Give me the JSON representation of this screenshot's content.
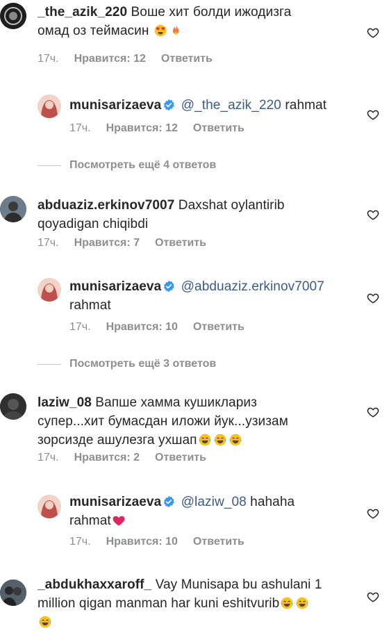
{
  "comments": [
    {
      "username": "_the_azik_220",
      "text": "Воше хит болди ижодизга омад оз теймасин",
      "line2": "омад оз теймасин",
      "time": "17ч.",
      "likes": "Нравится: 12",
      "reply": "Ответить"
    },
    {
      "username": "munisarizaeva",
      "mention": "@_the_azik_220",
      "text": "rahmat",
      "time": "17ч.",
      "likes": "Нравится: 12",
      "reply": "Ответить"
    },
    {
      "view_more": "Посмотреть ещё 4 ответов"
    },
    {
      "username": "abduaziz.erkinov7007",
      "text": "Daxshat oylantirib",
      "line2": "qoyadigan chiqibdi",
      "time": "17ч.",
      "likes": "Нравится: 7",
      "reply": "Ответить"
    },
    {
      "username": "munisarizaeva",
      "mention": "@abduaziz.erkinov7007",
      "line2": "rahmat",
      "time": "17ч.",
      "likes": "Нравится: 10",
      "reply": "Ответить"
    },
    {
      "view_more": "Посмотреть ещё 3 ответов"
    },
    {
      "username": "laziw_08",
      "text": "Вапше хамма кушиклариз",
      "line2": "супер...хит бумасдан иложи йук...узизам",
      "line3": "зорсизде ашулезга ухшап",
      "time": "17ч.",
      "likes": "Нравится: 2",
      "reply": "Ответить"
    },
    {
      "username": "munisarizaeva",
      "mention": "@laziw_08",
      "text": "hahaha",
      "line2": "rahmat",
      "time": "17ч.",
      "likes": "Нравится: 10",
      "reply": "Ответить"
    },
    {
      "username": "_abdukhaxxaroff_",
      "text": "Vay Munisapa bu ashulani 1",
      "line2": "million qigan manman har kuni eshitvurib"
    }
  ],
  "line1_c0": "Воше хит болди ижодизга",
  "colors": {
    "text": "#262626",
    "meta": "#8e8e8e",
    "mention": "#3b5a86",
    "verified": "#3897f0",
    "heart_red": "#e0245e"
  },
  "icons": [
    "heart-outline-icon",
    "verified-badge-icon",
    "heart-eyes-emoji",
    "fire-emoji",
    "tears-of-joy-emoji",
    "red-heart-emoji"
  ]
}
